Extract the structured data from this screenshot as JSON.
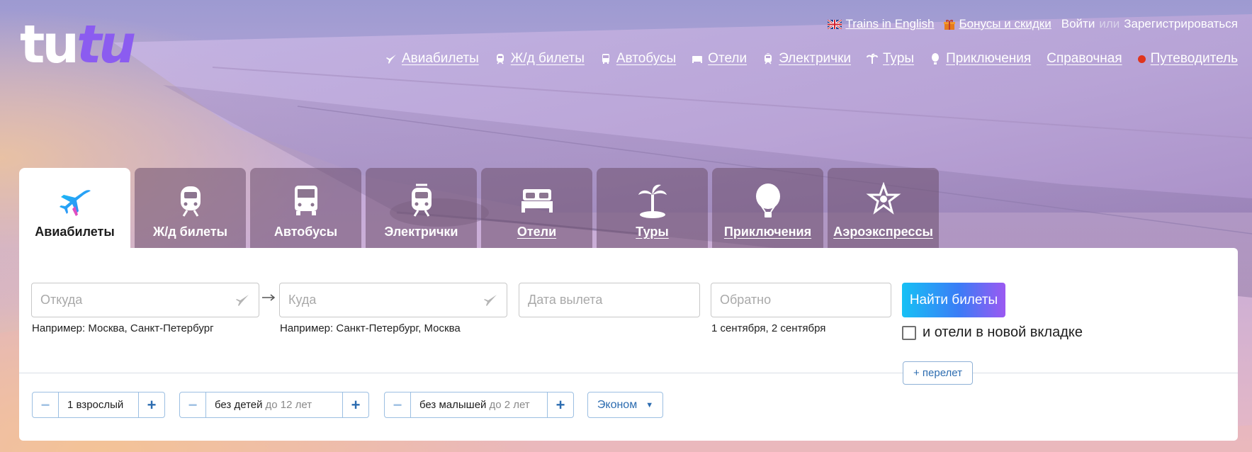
{
  "logo": {
    "part1": "tu",
    "part2": "tu"
  },
  "util": {
    "english_link": "Trains in English",
    "bonus_link": "Бонусы и скидки",
    "login": "Войти",
    "or": "или",
    "register": "Зарегистрироваться"
  },
  "nav": {
    "items": [
      {
        "label": "Авиабилеты",
        "icon": "plane-icon"
      },
      {
        "label": "Ж/д билеты",
        "icon": "train-icon"
      },
      {
        "label": "Автобусы",
        "icon": "bus-icon"
      },
      {
        "label": "Отели",
        "icon": "bed-icon"
      },
      {
        "label": "Электрички",
        "icon": "suburban-train-icon"
      },
      {
        "label": "Туры",
        "icon": "palm-icon"
      },
      {
        "label": "Приключения",
        "icon": "balloon-icon"
      },
      {
        "label": "Справочная",
        "icon": ""
      },
      {
        "label": "Путеводитель",
        "icon": "red-dot-icon"
      }
    ]
  },
  "tabs": [
    {
      "label": "Авиабилеты",
      "icon": "plane-icon",
      "active": true
    },
    {
      "label": "Ж/д билеты",
      "icon": "train-icon",
      "active": false
    },
    {
      "label": "Автобусы",
      "icon": "bus-icon",
      "active": false
    },
    {
      "label": "Электрички",
      "icon": "suburban-train-icon",
      "active": false
    },
    {
      "label": "Отели",
      "icon": "bed-icon",
      "active": false
    },
    {
      "label": "Туры",
      "icon": "palm-icon",
      "active": false
    },
    {
      "label": "Приключения",
      "icon": "balloon-icon",
      "active": false
    },
    {
      "label": "Аэроэкспрессы",
      "icon": "aeroexpress-icon",
      "active": false
    }
  ],
  "search": {
    "from": {
      "placeholder": "Откуда",
      "value": "",
      "hint": "Например: Москва, Санкт-Петербург"
    },
    "to": {
      "placeholder": "Куда",
      "value": "",
      "hint": "Например: Санкт-Петербург, Москва"
    },
    "depart": {
      "placeholder": "Дата вылета",
      "value": ""
    },
    "return": {
      "placeholder": "Обратно",
      "value": "",
      "hint": "1 сентября, 2 сентября"
    },
    "find_button": "Найти билеты",
    "hotels_checkbox": "и отели в новой вкладке",
    "hotels_checked": false,
    "add_flight": "+ перелет"
  },
  "passengers": {
    "adults": {
      "value": "1 взрослый"
    },
    "children": {
      "value": "без детей",
      "sub": "до 12 лет"
    },
    "infants": {
      "value": "без малышей",
      "sub": "до 2 лет"
    },
    "class": {
      "value": "Эконом"
    }
  },
  "colors": {
    "accent": "#2c6cb0",
    "button_gradient_start": "#16c1f5",
    "button_gradient_end": "#9b59f2",
    "logo_purple": "#8b5cf0",
    "guide_dot": "#e0341e"
  }
}
